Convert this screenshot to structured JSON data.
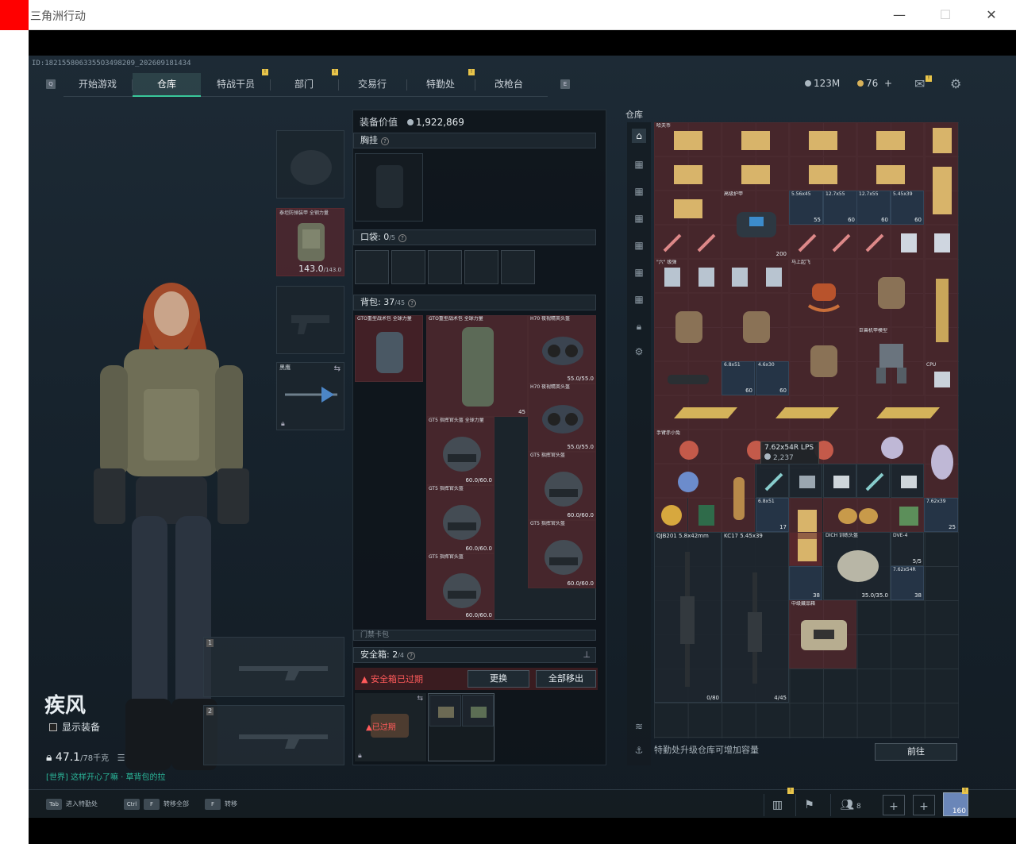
{
  "window": {
    "title": "三角洲行动",
    "min": "—",
    "max": "☐",
    "close": "✕"
  },
  "uid": "ID:1821558063355O3498209_202609181434",
  "nav": {
    "left_key": "Q",
    "right_key": "E",
    "tabs": [
      "开始游戏",
      "仓库",
      "特战干员",
      "部门",
      "交易行",
      "特勤处",
      "改枪台"
    ],
    "active": "仓库"
  },
  "currency": {
    "tickets": "123M",
    "coins": "76",
    "plus": "+"
  },
  "colors": {
    "accent": "#39c79a",
    "rare_red": "#7a2c33",
    "warning": "#e04848"
  },
  "character": {
    "name": "疾风",
    "show_equipment": "显示装备",
    "weight_value": "47.1",
    "weight_max": "/78千克",
    "warning": "[世界] 这样开心了嘛 · 草背包的拉"
  },
  "slots": {
    "armor_label": "泰坦防弹装甲 全钢力量",
    "armor_value": "143.0",
    "armor_max": "/143.0",
    "melee_label": "黑鹰",
    "slot_1": "1",
    "slot_2": "2"
  },
  "loadout": {
    "value_label": "装备价值",
    "value": "1,922,869",
    "chest_label": "胸挂",
    "pocket_label": "口袋:",
    "pocket_value": "0",
    "pocket_max": "/5",
    "backpack_label": "背包:",
    "backpack_value": "37",
    "backpack_max": "/45",
    "backpack_items": [
      {
        "name": "GTO重型战术包 全球力量",
        "count": ""
      },
      {
        "name": "GTO重型战术包 全球力量",
        "count": "45"
      },
      {
        "name": "H70 夜视精英头盔",
        "count": "55.0/55.0"
      },
      {
        "name": "H70 夜视精英头盔",
        "count": "55.0/55.0"
      },
      {
        "name": "GT5 指挥官头盔 全球力量",
        "count": "60.0/60.0"
      },
      {
        "name": "GT5 指挥官头盔",
        "count": "60.0/60.0"
      },
      {
        "name": "GT5 指挥官头盔",
        "count": "60.0/60.0"
      },
      {
        "name": "GT5 指挥官头盔",
        "count": "60.0/60.0"
      },
      {
        "name": "GT5 指挥官头盔",
        "count": "60.0/60.0"
      }
    ],
    "gate_label": "门禁卡包",
    "safe_label": "安全箱:",
    "safe_value": "2",
    "safe_max": "/4",
    "safe_expired": "安全箱已过期",
    "btn_replace": "更换",
    "btn_remove_all": "全部移出",
    "expired_tag": "已过期"
  },
  "storage": {
    "title": "仓库",
    "upgrade_hint": "特勤处升级仓库可增加容量",
    "goto": "前往",
    "tooltip_name": "7.62x54R LPS",
    "tooltip_value": "2,237",
    "items": [
      {
        "name": "哈夫币",
        "count": ""
      },
      {
        "name": "5.56x45",
        "count": "55"
      },
      {
        "name": "12.7x55",
        "count": "60"
      },
      {
        "name": "12.7x55",
        "count": "60"
      },
      {
        "name": "5.45x39",
        "count": "60"
      },
      {
        "name": "高级护甲",
        "count": "200"
      },
      {
        "name": "\"六\" 级弹",
        "count": ""
      },
      {
        "name": "马上起飞",
        "count": ""
      },
      {
        "name": "巨兽机甲模型",
        "count": ""
      },
      {
        "name": "CPU",
        "count": ""
      },
      {
        "name": "6.8x51",
        "count": "60"
      },
      {
        "name": "4.6x30",
        "count": "60"
      },
      {
        "name": "手臂赤小兔",
        "count": ""
      },
      {
        "name": "QJB201 5.8x42mm",
        "count": "0/80"
      },
      {
        "name": "KC17 5.45x39",
        "count": "4/45"
      },
      {
        "name": "DICH 训练头盔",
        "count": "35.0/35.0"
      },
      {
        "name": "DVE-4",
        "count": "5/5"
      },
      {
        "name": "7.62x54R",
        "count": "38"
      },
      {
        "name": "中级藏品箱",
        "count": ""
      },
      {
        "name": "7.62x39",
        "count": "25"
      },
      {
        "name": "6.8x51",
        "count": "17"
      }
    ]
  },
  "bottombar": {
    "hint1_key": "Tab",
    "hint1": "进入特勤处",
    "hint2_key1": "Ctrl",
    "hint2_key2": "F",
    "hint2": "转移全部",
    "hint3_key": "F",
    "hint3": "转移",
    "friends_count": "8",
    "avatar_level": "160"
  }
}
